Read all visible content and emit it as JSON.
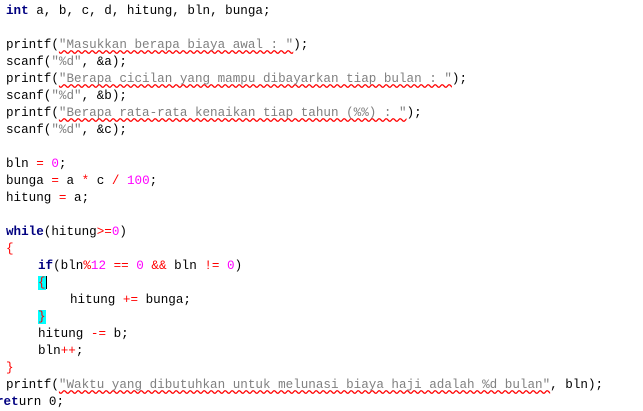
{
  "code": {
    "l1": [
      "int",
      " a, b, c, d, hitung, bln, bunga;"
    ],
    "l3": [
      "printf(",
      "\"Masukkan berapa biaya awal : \"",
      ");"
    ],
    "l4": [
      "scanf(",
      "\"%d\"",
      ", &a);"
    ],
    "l5": [
      "printf(",
      "\"Berapa cicilan yang mampu dibayarkan tiap bulan : \"",
      ");"
    ],
    "l6": [
      "scanf(",
      "\"%d\"",
      ", &b);"
    ],
    "l7": [
      "printf(",
      "\"Berapa rata-rata kenaikan tiap tahun (%%) : \"",
      ");"
    ],
    "l8": [
      "scanf(",
      "\"%d\"",
      ", &c);"
    ],
    "l10": [
      "bln ",
      "=",
      " ",
      "0",
      ";"
    ],
    "l11": [
      "bunga ",
      "=",
      " a ",
      "*",
      " c ",
      "/",
      " ",
      "100",
      ";"
    ],
    "l12": [
      "hitung ",
      "=",
      " a;"
    ],
    "l14": [
      "while",
      "(hitung",
      ">=",
      "0",
      ")"
    ],
    "l15": [
      "{"
    ],
    "l16": [
      "if",
      "(bln",
      "%",
      "12",
      " ",
      "==",
      " ",
      "0",
      " ",
      "&&",
      " bln ",
      "!=",
      " ",
      "0",
      ")"
    ],
    "l17": [
      "{"
    ],
    "l18": [
      "hitung ",
      "+=",
      " bunga;"
    ],
    "l19": [
      "}"
    ],
    "l20": [
      "hitung ",
      "-=",
      " b;"
    ],
    "l21": [
      "bln",
      "++",
      ";"
    ],
    "l22": [
      "}"
    ],
    "l23": [
      "printf(",
      "\"Waktu yang dibutuhkan untuk melunasi biaya haji adalah %d bulan\"",
      ", bln);"
    ],
    "l24": [
      "ret",
      "urn 0;"
    ]
  },
  "colors": {
    "keyword": "#000080",
    "string": "#808080",
    "number": "#ff00ff",
    "operator": "#ff0000",
    "brace_highlight": "#00ffff"
  }
}
